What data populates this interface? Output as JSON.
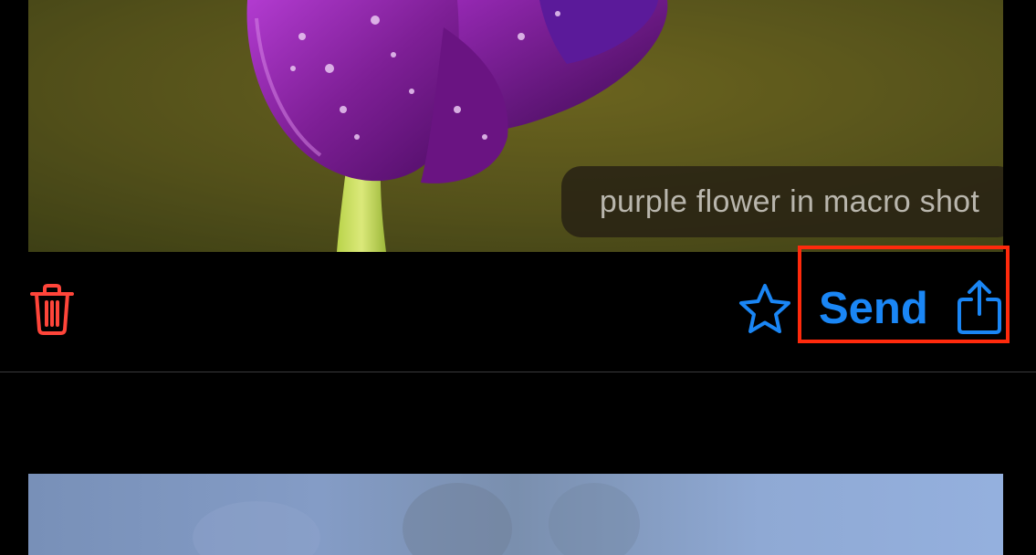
{
  "colors": {
    "accent": "#1a86f5",
    "delete": "#ff453a",
    "highlight_border": "#ff2a0c",
    "background": "#000000",
    "divider": "#3a3a3c"
  },
  "post": {
    "image_alt_caption": "purple flower in macro shot",
    "actions": {
      "delete_icon": "trash-icon",
      "favorite_icon": "star-icon",
      "send_label": "Send",
      "share_icon": "share-icon"
    }
  },
  "next_post": {
    "image_icon": "photo-thumbnail"
  }
}
